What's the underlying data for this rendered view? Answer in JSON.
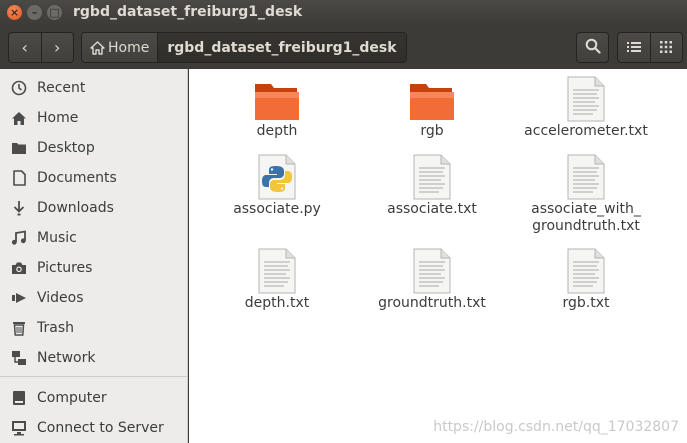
{
  "window": {
    "title": "rgbd_dataset_freiburg1_desk"
  },
  "window_buttons": {
    "close": "×",
    "minimize": "–",
    "maximize": "□"
  },
  "toolbar": {
    "back_glyph": "‹",
    "forward_glyph": "›",
    "path": [
      {
        "label": "Home",
        "icon": "home-icon"
      },
      {
        "label": "rgbd_dataset_freiburg1_desk"
      }
    ]
  },
  "sidebar": {
    "items": [
      {
        "label": "Recent",
        "icon": "clock-icon"
      },
      {
        "label": "Home",
        "icon": "home-icon"
      },
      {
        "label": "Desktop",
        "icon": "folder-icon"
      },
      {
        "label": "Documents",
        "icon": "document-icon"
      },
      {
        "label": "Downloads",
        "icon": "download-icon"
      },
      {
        "label": "Music",
        "icon": "music-icon"
      },
      {
        "label": "Pictures",
        "icon": "camera-icon"
      },
      {
        "label": "Videos",
        "icon": "video-icon"
      },
      {
        "label": "Trash",
        "icon": "trash-icon"
      },
      {
        "label": "Network",
        "icon": "network-icon"
      },
      {
        "label": "Computer",
        "icon": "computer-icon"
      },
      {
        "label": "Connect to Server",
        "icon": "server-icon"
      }
    ]
  },
  "files": [
    {
      "name": "depth",
      "type": "folder"
    },
    {
      "name": "rgb",
      "type": "folder"
    },
    {
      "name": "accelerometer.txt",
      "type": "text"
    },
    {
      "name": "associate.py",
      "type": "python"
    },
    {
      "name": "associate.txt",
      "type": "text"
    },
    {
      "name": "associate_with_\ngroundtruth.txt",
      "type": "text"
    },
    {
      "name": "depth.txt",
      "type": "text"
    },
    {
      "name": "groundtruth.txt",
      "type": "text"
    },
    {
      "name": "rgb.txt",
      "type": "text"
    }
  ],
  "watermark": "https://blog.csdn.net/qq_17032807",
  "colors": {
    "accent": "#e95420",
    "folder": "#f06a35",
    "sidebar_bg": "#edeceb",
    "titlebar": "#3c3b37"
  }
}
